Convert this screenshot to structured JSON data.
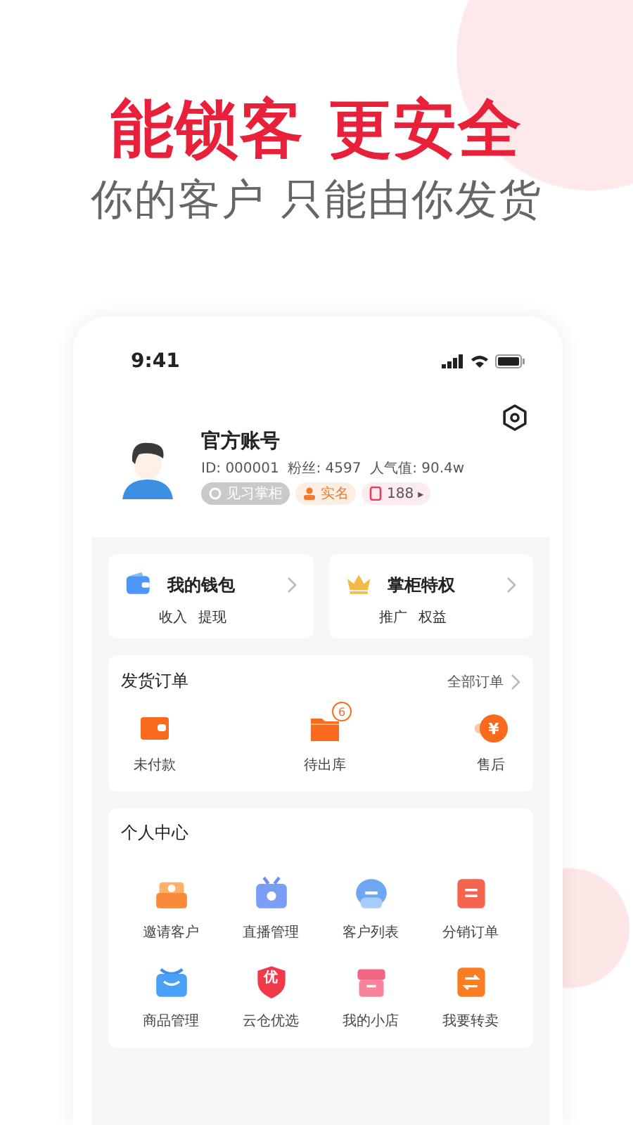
{
  "headline": "能锁客 更安全",
  "subtitle": "你的客户 只能由你发货",
  "status_bar": {
    "time": "9:41"
  },
  "profile": {
    "name": "官方账号",
    "stats": "ID: 000001  粉丝: 4597  人气值: 90.4w",
    "tags": [
      {
        "kind": "level",
        "label": "见习掌柜"
      },
      {
        "kind": "verified",
        "label": "实名"
      },
      {
        "kind": "phone",
        "label": "188",
        "arrow": "▸"
      }
    ]
  },
  "shortcuts": [
    {
      "kind": "wallet",
      "title": "我的钱包",
      "links": [
        "收入",
        "提现"
      ]
    },
    {
      "kind": "crown",
      "title": "掌柜特权",
      "links": [
        "推广",
        "权益"
      ]
    }
  ],
  "orders": {
    "title": "发货订单",
    "more": "全部订单",
    "items": [
      {
        "kind": "unpaid",
        "label": "未付款"
      },
      {
        "kind": "pending",
        "label": "待出库",
        "badge": "6"
      },
      {
        "kind": "after_sale",
        "label": "售后",
        "glyph": "¥"
      }
    ]
  },
  "personal_center": {
    "title": "个人中心",
    "items": [
      {
        "kind": "invite",
        "label": "邀请客户"
      },
      {
        "kind": "live",
        "label": "直播管理"
      },
      {
        "kind": "customers",
        "label": "客户列表"
      },
      {
        "kind": "distribution",
        "label": "分销订单"
      },
      {
        "kind": "goods",
        "label": "商品管理"
      },
      {
        "kind": "select",
        "label": "云仓优选",
        "glyph": "优"
      },
      {
        "kind": "shop",
        "label": "我的小店"
      },
      {
        "kind": "resell",
        "label": "我要转卖"
      }
    ]
  }
}
